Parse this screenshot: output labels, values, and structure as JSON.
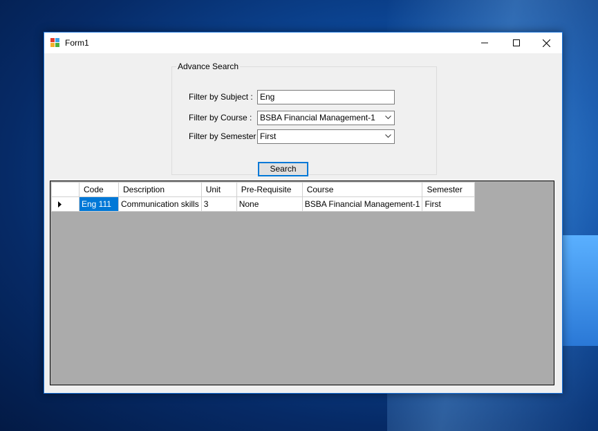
{
  "window": {
    "title": "Form1",
    "accent_color": "#0078d7"
  },
  "groupbox": {
    "title": "Advance Search"
  },
  "filters": {
    "subject_label": "Filter by Subject :",
    "subject_value": "Eng",
    "course_label": "Filter by Course :",
    "course_value": "BSBA Financial Management-1",
    "semester_label": "Filter by Semester :",
    "semester_value": "First"
  },
  "search_button": {
    "label": "Search"
  },
  "grid": {
    "columns": [
      "Code",
      "Description",
      "Unit",
      "Pre-Requisite",
      "Course",
      "Semester"
    ],
    "rows": [
      [
        "Eng 111",
        "Communication skills",
        "3",
        "None",
        "BSBA Financial Management-1",
        "First"
      ]
    ]
  },
  "icons": {
    "app": "app-icon",
    "minimize": "minimize-icon",
    "maximize": "maximize-icon",
    "close": "close-icon",
    "row_pointer": "row-pointer-icon"
  }
}
